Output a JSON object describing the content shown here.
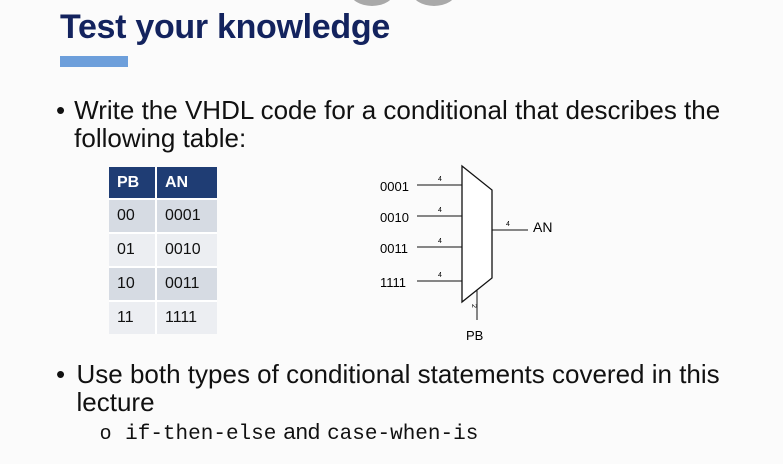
{
  "slide": {
    "title": "Test your knowledge",
    "bullet1": "Write the VHDL code for a conditional that describes the following table:",
    "bullet2": "Use both types of conditional statements covered in this lecture",
    "sub_marker": "o",
    "sub_code1": "if-then-else",
    "sub_and": "and",
    "sub_code2": "case-when-is",
    "bullet_symbol": "•"
  },
  "table": {
    "headers": [
      "PB",
      "AN"
    ],
    "rows": [
      [
        "00",
        "0001"
      ],
      [
        "01",
        "0010"
      ],
      [
        "10",
        "0011"
      ],
      [
        "11",
        "1111"
      ]
    ]
  },
  "diagram": {
    "inputs": [
      "0001",
      "0010",
      "0011",
      "1111"
    ],
    "input_width": "4",
    "output_label": "AN",
    "output_width": "4",
    "select_label": "PB",
    "select_width": "2"
  },
  "colors": {
    "title": "#13235e",
    "accent_bar": "#6d9fdb",
    "table_header": "#1f3d74",
    "row_odd": "#d6dbe3",
    "row_even": "#eceef2"
  }
}
